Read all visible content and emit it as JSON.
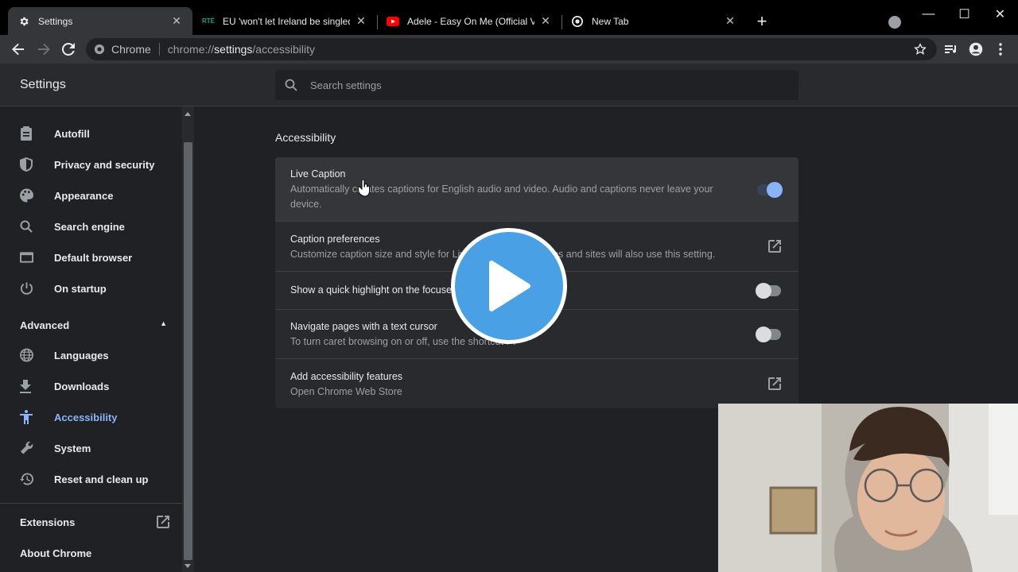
{
  "browser": {
    "tabs": [
      {
        "title": "Settings",
        "favicon": "gear-icon"
      },
      {
        "title": "EU 'won't let Ireland be singled o",
        "favicon": "rte-icon"
      },
      {
        "title": "Adele - Easy On Me (Official Vide",
        "favicon": "youtube-icon"
      },
      {
        "title": "New Tab",
        "favicon": "chrome-icon"
      }
    ],
    "omnibox": {
      "chip": "Chrome",
      "scheme": "chrome://",
      "host": "settings",
      "path": "/accessibility"
    }
  },
  "settings": {
    "title": "Settings",
    "search_placeholder": "Search settings",
    "sidebar": {
      "items": [
        {
          "label": "Autofill",
          "icon": "clipboard-icon"
        },
        {
          "label": "Privacy and security",
          "icon": "shield-icon"
        },
        {
          "label": "Appearance",
          "icon": "palette-icon"
        },
        {
          "label": "Search engine",
          "icon": "search-icon"
        },
        {
          "label": "Default browser",
          "icon": "browser-icon"
        },
        {
          "label": "On startup",
          "icon": "power-icon"
        }
      ],
      "advanced_label": "Advanced",
      "advanced_items": [
        {
          "label": "Languages",
          "icon": "globe-icon"
        },
        {
          "label": "Downloads",
          "icon": "download-icon"
        },
        {
          "label": "Accessibility",
          "icon": "accessibility-icon",
          "active": true
        },
        {
          "label": "System",
          "icon": "wrench-icon"
        },
        {
          "label": "Reset and clean up",
          "icon": "history-icon"
        }
      ],
      "extensions_label": "Extensions",
      "about_label": "About Chrome"
    },
    "section_title": "Accessibility",
    "rows": [
      {
        "title": "Live Caption",
        "subtitle": "Automatically creates captions for English audio and video. Audio and captions never leave your device.",
        "control": "toggle",
        "on": true
      },
      {
        "title": "Caption preferences",
        "subtitle": "Customize caption size and style for Live Caption. Some apps and sites will also use this setting.",
        "control": "external-link"
      },
      {
        "title": "Show a quick highlight on the focused object",
        "subtitle": "",
        "control": "toggle",
        "on": false
      },
      {
        "title": "Navigate pages with a text cursor",
        "subtitle": "To turn caret browsing on or off, use the shortcut F7",
        "control": "toggle",
        "on": false
      },
      {
        "title": "Add accessibility features",
        "subtitle": "Open Chrome Web Store",
        "control": "external-link"
      }
    ]
  },
  "overlay": {
    "play_button": "play-icon",
    "webcam": "webcam-feed"
  },
  "colors": {
    "accent": "#8ab4f8",
    "background": "#202124",
    "surface": "#292a2d",
    "play": "#4aa0e4"
  }
}
